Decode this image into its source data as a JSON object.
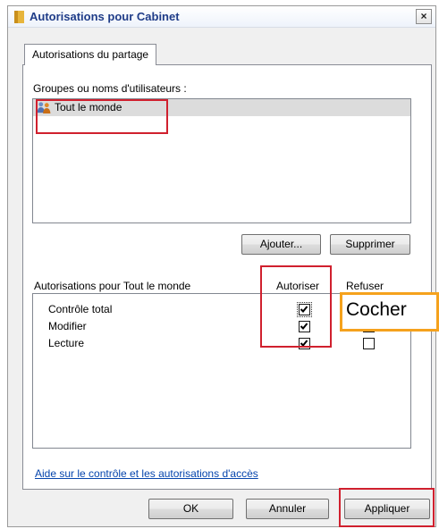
{
  "window": {
    "title": "Autorisations pour Cabinet",
    "close_glyph": "×"
  },
  "tab": {
    "label": "Autorisations du partage"
  },
  "groups": {
    "label": "Groupes ou noms d'utilisateurs :",
    "users": [
      {
        "name": "Tout le monde",
        "icon": "users-group-icon"
      }
    ]
  },
  "buttons": {
    "add": "Ajouter...",
    "remove": "Supprimer",
    "ok": "OK",
    "cancel": "Annuler",
    "apply": "Appliquer"
  },
  "permissions": {
    "header": "Autorisations pour Tout le monde",
    "allow_header": "Autoriser",
    "deny_header": "Refuser",
    "rows": [
      {
        "label": "Contrôle total",
        "allow": true,
        "deny": false
      },
      {
        "label": "Modifier",
        "allow": true,
        "deny": false
      },
      {
        "label": "Lecture",
        "allow": true,
        "deny": false
      }
    ]
  },
  "help_link": "Aide sur le contrôle et les autorisations d'accès",
  "annotation": {
    "text": "Cocher"
  },
  "colors": {
    "highlight_red": "#d0202e",
    "annotation_orange": "#f5a21d",
    "link_blue": "#0645ad",
    "title_blue": "#1f3c88"
  }
}
